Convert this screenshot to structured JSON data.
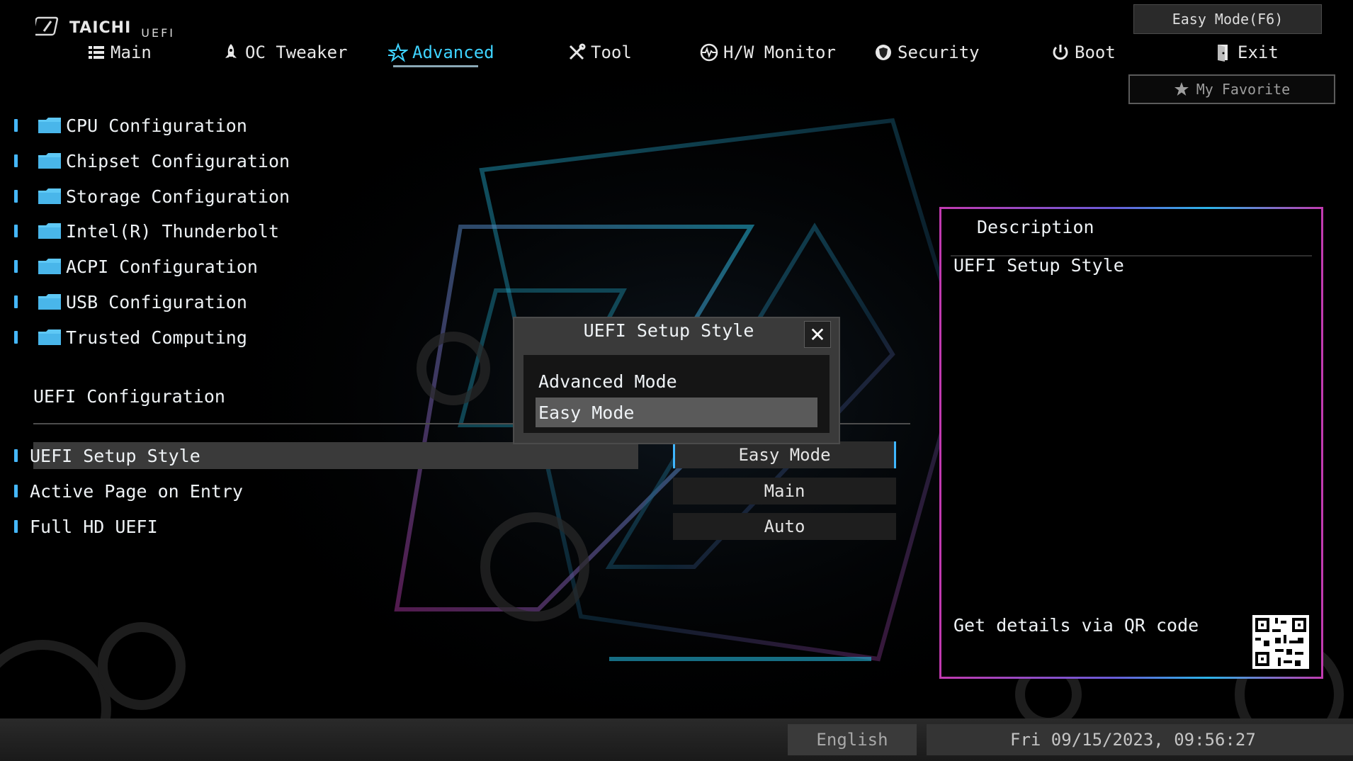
{
  "logo": {
    "brand": "TAICHI",
    "sub": "UEFI"
  },
  "nav": [
    {
      "label": "Main",
      "icon": "list-icon"
    },
    {
      "label": "OC Tweaker",
      "icon": "rocket-icon"
    },
    {
      "label": "Advanced",
      "icon": "star-icon",
      "active": true
    },
    {
      "label": "Tool",
      "icon": "tools-icon"
    },
    {
      "label": "H/W Monitor",
      "icon": "monitor-icon"
    },
    {
      "label": "Security",
      "icon": "shield-icon"
    },
    {
      "label": "Boot",
      "icon": "power-icon"
    },
    {
      "label": "Exit",
      "icon": "exit-door-icon"
    }
  ],
  "easy_mode_button": "Easy Mode(F6)",
  "favorite_button": "My Favorite",
  "menu": [
    "CPU Configuration",
    "Chipset Configuration",
    "Storage Configuration",
    "Intel(R) Thunderbolt",
    "ACPI Configuration",
    "USB Configuration",
    "Trusted Computing"
  ],
  "section_title": "UEFI Configuration",
  "settings": [
    {
      "label": "UEFI Setup Style",
      "value": "Easy Mode",
      "selected": true
    },
    {
      "label": "Active Page on Entry",
      "value": "Main"
    },
    {
      "label": "Full HD UEFI",
      "value": "Auto"
    }
  ],
  "description": {
    "title": "Description",
    "text": "UEFI Setup Style",
    "qr_text": "Get details via QR code"
  },
  "modal": {
    "title": "UEFI Setup Style",
    "options": [
      "Advanced Mode",
      "Easy Mode"
    ],
    "selected": "Easy Mode"
  },
  "footer": {
    "language": "English",
    "datetime": "Fri 09/15/2023, 09:56:27"
  },
  "colors": {
    "accent": "#3ed3ff",
    "bullet": "#45b8ff",
    "frame_pink": "#c23ab0",
    "frame_blue": "#2bb4e8"
  }
}
